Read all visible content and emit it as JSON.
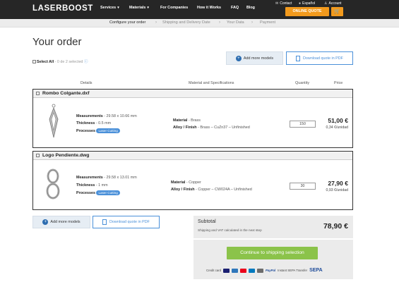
{
  "header": {
    "logo": "LASERBOOST",
    "nav": [
      "Services",
      "Materials",
      "For Companies",
      "How it Works",
      "FAQ",
      "Blog"
    ],
    "top_links": [
      "Contact",
      "Español",
      "Account"
    ],
    "quote_label": "ONLINE QUOTE"
  },
  "steps": [
    "Configure your order",
    "Shipping and Delivery Date",
    "Your Data",
    "Payment"
  ],
  "page_title": "Your order",
  "select_all": {
    "label": "Select All",
    "count": "- 0 de 2 selected"
  },
  "actions": {
    "add_models": "Add more models",
    "download_pdf": "Download quote in PDF"
  },
  "columns": {
    "details": "Details",
    "material": "Material and Specifications",
    "quantity": "Quantity",
    "price": "Price"
  },
  "items": [
    {
      "name": "Rombo Colgante.dxf",
      "measurements_label": "Measurements",
      "measurements": "- 29.58 x 10.66 mm",
      "thickness_label": "Thickness",
      "thickness": "- 0.5 mm",
      "processes_label": "Processes",
      "process": "Laser Cutting",
      "material_label": "Material",
      "material": "- Brass",
      "alloy_label": "Alloy / Finish",
      "alloy": "- Brass – CuZn37 – Unfinished",
      "quantity": "150",
      "price": "51,00 €",
      "unit_price": "0,34 €/unidad"
    },
    {
      "name": "Logo Pendiente.dwg",
      "measurements_label": "Measurements",
      "measurements": "- 29.58 x 13.01 mm",
      "thickness_label": "Thickness",
      "thickness": "- 1 mm",
      "processes_label": "Processes",
      "process": "Laser Cutting",
      "material_label": "Material",
      "material": "- Copper",
      "alloy_label": "Alloy / Finish",
      "alloy": "- Copper – CW024A – Unfinished",
      "quantity": "30",
      "price": "27,90 €",
      "unit_price": "0,93 €/unidad"
    }
  ],
  "subtotal": {
    "label": "Subtotal",
    "note": "Shipping and VAT calculated in the next step",
    "amount": "78,90 €"
  },
  "checkout": {
    "continue_label": "Continue to shipping selection",
    "credit_card": "Credit card",
    "paypal": "PayPal",
    "instant_sepa": "Instant SEPA Transfer",
    "sepa": "SEPA"
  },
  "colors": {
    "accent": "#f29a1d",
    "primary": "#4a90d9",
    "success": "#8bc34a",
    "topbar": "#262626"
  }
}
